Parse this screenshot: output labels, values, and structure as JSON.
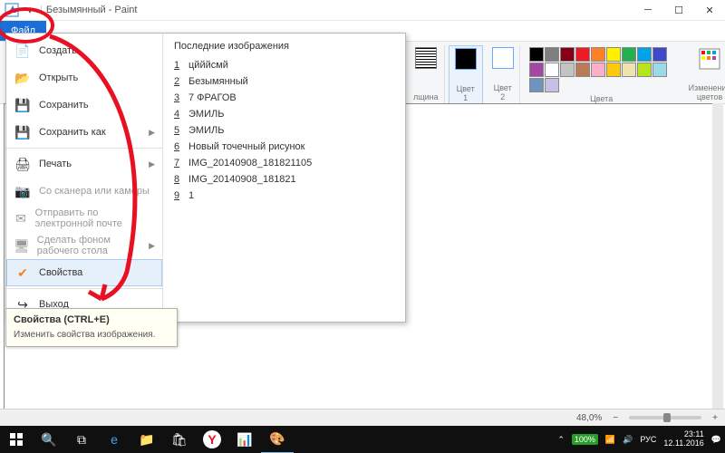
{
  "window": {
    "title": "Безымянный - Paint",
    "file_tab": "Файл"
  },
  "ribbon": {
    "thickness_label": "лщина",
    "color1_label": "Цвет\n1",
    "color2_label": "Цвет\n2",
    "colors_group": "Цвета",
    "edit_colors": "Изменение\nцветов",
    "swatches": [
      "#000",
      "#7f7f7f",
      "#880015",
      "#ed1c24",
      "#ff7f27",
      "#fff200",
      "#22b14c",
      "#00a2e8",
      "#3f48cc",
      "#a349a4",
      "#fff",
      "#c3c3c3",
      "#b97a57",
      "#ffaec9",
      "#ffc90e",
      "#efe4b0",
      "#b5e61d",
      "#99d9ea",
      "#7092be",
      "#c8bfe7"
    ]
  },
  "file_menu": {
    "items": [
      {
        "label": "Создать",
        "icon": "new",
        "arrow": false,
        "dis": false
      },
      {
        "label": "Открыть",
        "icon": "open",
        "arrow": false,
        "dis": false
      },
      {
        "label": "Сохранить",
        "icon": "save",
        "arrow": false,
        "dis": false
      },
      {
        "label": "Сохранить как",
        "icon": "saveas",
        "arrow": true,
        "dis": false
      },
      {
        "label": "Печать",
        "icon": "print",
        "arrow": true,
        "dis": false
      },
      {
        "label": "Со сканера или камеры",
        "icon": "scan",
        "arrow": false,
        "dis": true
      },
      {
        "label": "Отправить по электронной почте",
        "icon": "mail",
        "arrow": false,
        "dis": true
      },
      {
        "label": "Сделать фоном рабочего стола",
        "icon": "wall",
        "arrow": true,
        "dis": true
      },
      {
        "label": "Свойства",
        "icon": "props",
        "arrow": false,
        "dis": false,
        "hover": true
      },
      {
        "label": "Выход",
        "icon": "exit",
        "arrow": false,
        "dis": false
      }
    ],
    "recent_title": "Последние изображения",
    "recent": [
      {
        "n": "1",
        "name": "цйййсмй"
      },
      {
        "n": "2",
        "name": "Безымянный"
      },
      {
        "n": "3",
        "name": "7 ФРАГОВ"
      },
      {
        "n": "4",
        "name": "ЭМИЛЬ"
      },
      {
        "n": "5",
        "name": "ЭМИЛЬ"
      },
      {
        "n": "6",
        "name": "Новый точечный рисунок"
      },
      {
        "n": "7",
        "name": "IMG_20140908_181821105"
      },
      {
        "n": "8",
        "name": "IMG_20140908_181821"
      },
      {
        "n": "9",
        "name": "1"
      }
    ]
  },
  "tooltip": {
    "title": "Свойства (CTRL+E)",
    "body": "Изменить свойства изображения."
  },
  "status": {
    "zoom": "48,0%"
  },
  "tray": {
    "batt": "100%",
    "lang": "РУС",
    "time": "23:11",
    "date": "12.11.2016"
  },
  "icons": {
    "new": "📄",
    "open": "📂",
    "save": "💾",
    "saveas": "💾",
    "print": "🖨",
    "scan": "📷",
    "mail": "✉",
    "wall": "🖥",
    "props": "✔",
    "exit": "↪"
  }
}
